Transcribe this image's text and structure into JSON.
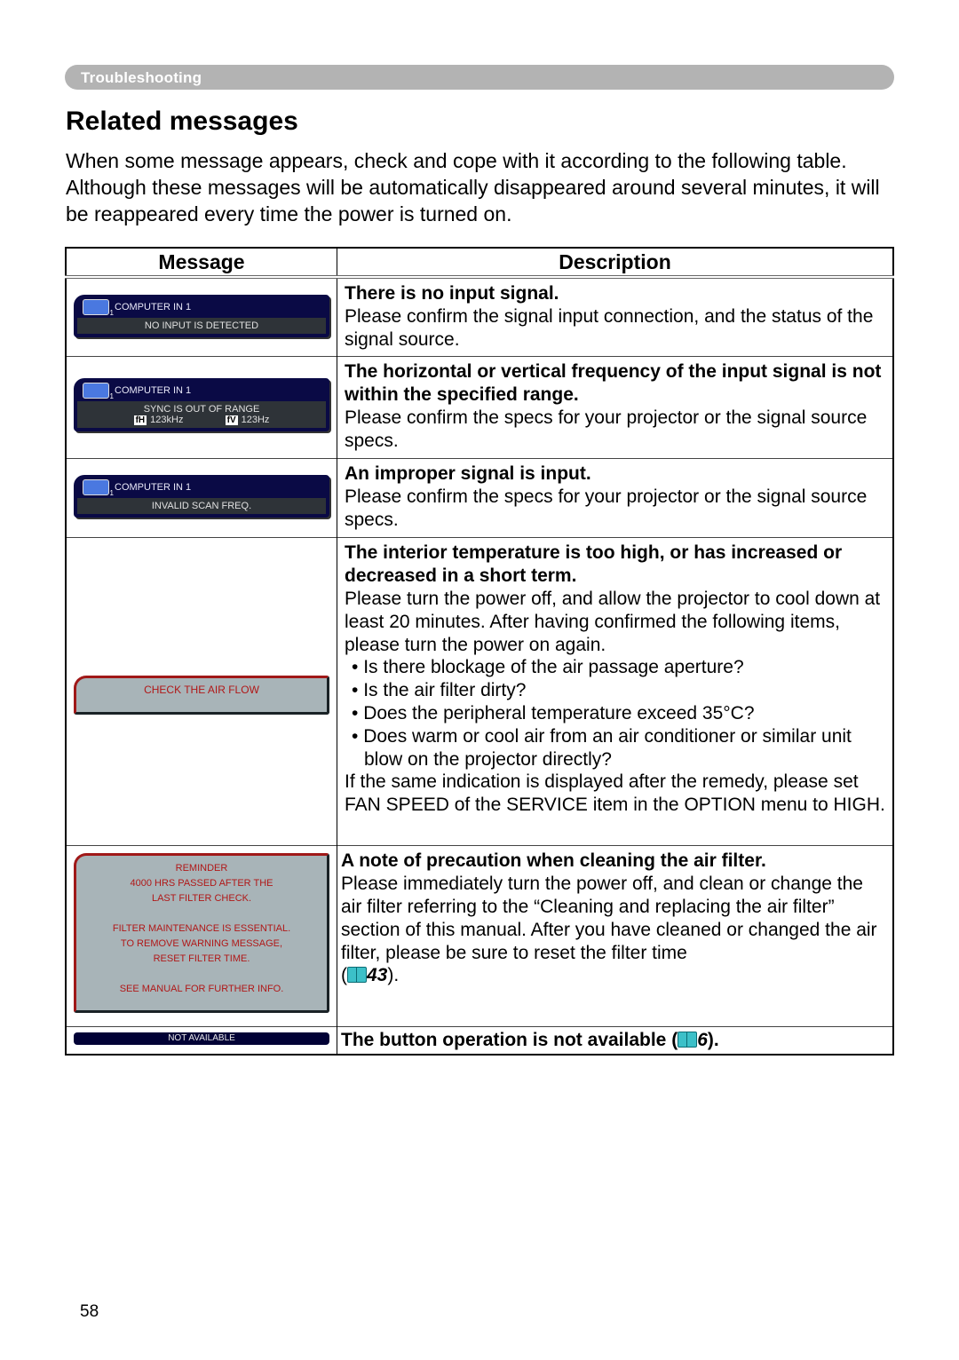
{
  "section": "Troubleshooting",
  "title": "Related messages",
  "intro": "When some message appears, check and cope with it according to the following table. Although these messages will be automatically disappeared around several minutes, it will be reappeared every time the power is turned on.",
  "table": {
    "headers": [
      "Message",
      "Description"
    ],
    "rows": [
      {
        "osd": {
          "type": "dark",
          "source": "COMPUTER IN 1",
          "lines": [
            "NO INPUT IS DETECTED"
          ]
        },
        "title": "There is no input signal.",
        "body": "Please confirm the signal input connection, and the status of the signal source."
      },
      {
        "osd": {
          "type": "dark",
          "source": "COMPUTER IN 1",
          "lines": [
            "SYNC IS OUT OF RANGE"
          ],
          "fh_label": "fH",
          "fh": "123kHz",
          "fv_label": "fV",
          "fv": "123Hz"
        },
        "title": "The horizontal or vertical frequency of the input signal is not within the specified range.",
        "body": "Please confirm the specs for your projector or the signal source specs."
      },
      {
        "osd": {
          "type": "dark",
          "source": "COMPUTER IN 1",
          "lines": [
            "INVALID SCAN FREQ."
          ]
        },
        "title": "An improper signal is input.",
        "body": "Please confirm the specs for your projector or the signal source specs."
      },
      {
        "osd": {
          "type": "warn",
          "lines": [
            "CHECK THE AIR FLOW"
          ]
        },
        "title": "The interior temperature is too high, or has increased or decreased in a short term.",
        "body": "Please turn the power off, and allow the projector to cool down at least 20 minutes. After having confirmed the following items, please turn the power on again.",
        "bullets": [
          "Is there blockage of the air passage aperture?",
          "Is the air filter dirty?",
          "Does the peripheral temperature exceed 35°C?",
          "Does warm or cool air from an air conditioner or similar unit blow on the projector directly?"
        ],
        "footer": "If the same indication is displayed after the remedy, please set FAN SPEED of the SERVICE item in the OPTION menu to HIGH."
      },
      {
        "osd": {
          "type": "warn",
          "lines": [
            "REMINDER",
            "4000 HRS PASSED AFTER THE",
            "LAST FILTER CHECK.",
            "",
            "FILTER MAINTENANCE IS ESSENTIAL.",
            "TO REMOVE WARNING MESSAGE,",
            "RESET FILTER TIME.",
            "",
            "SEE MANUAL FOR FURTHER INFO."
          ]
        },
        "title": "A note of precaution when cleaning the air filter.",
        "body": "Please immediately turn the power off, and clean or change the air filter referring to the “Cleaning and replacing the air filter” section of this manual. After you have cleaned or changed the air filter, please be sure to reset the filter time",
        "ref": "43"
      },
      {
        "osd": {
          "type": "na",
          "lines": [
            "NOT AVAILABLE"
          ]
        },
        "title": "The button operation is not available",
        "ref": "6"
      }
    ]
  },
  "page_number": "58"
}
